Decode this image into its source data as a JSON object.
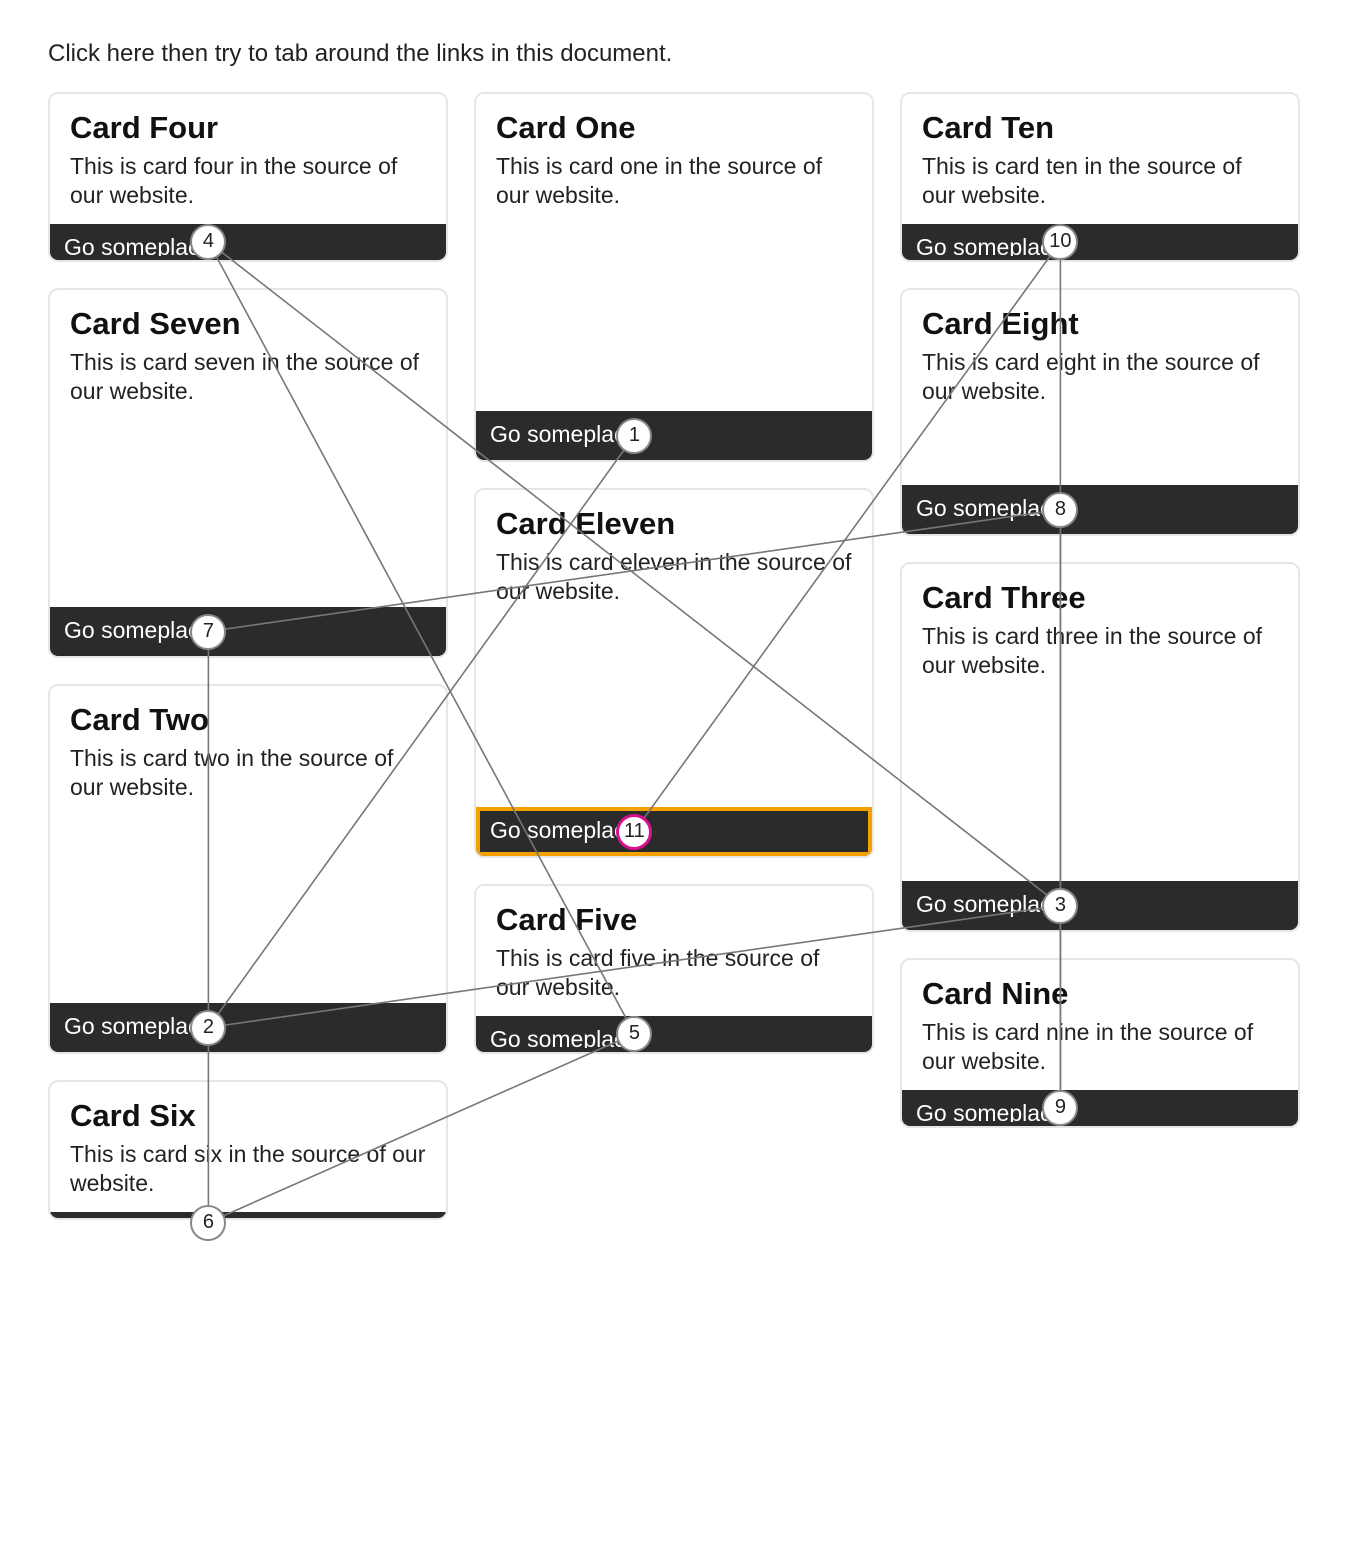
{
  "intro": "Click here then try to tab around the links in this document.",
  "link_label": "Go someplace",
  "focused_tab": 11,
  "cards": {
    "one": {
      "title": "Card One",
      "body": "This is card one in the source of our website.",
      "tab": 1
    },
    "two": {
      "title": "Card Two",
      "body": "This is card two in the source of our website.",
      "tab": 2
    },
    "three": {
      "title": "Card Three",
      "body": "This is card three in the source of our website.",
      "tab": 3
    },
    "four": {
      "title": "Card Four",
      "body": "This is card four in the source of our website.",
      "tab": 4
    },
    "five": {
      "title": "Card Five",
      "body": "This is card five in the source of our website.",
      "tab": 5
    },
    "six": {
      "title": "Card Six",
      "body": "This is card six in the source of our website.",
      "tab": 6
    },
    "seven": {
      "title": "Card Seven",
      "body": "This is card seven in the source of our website.",
      "tab": 7
    },
    "eight": {
      "title": "Card Eight",
      "body": "This is card eight in the source of our website.",
      "tab": 8
    },
    "nine": {
      "title": "Card Nine",
      "body": "This is card nine in the source of our website.",
      "tab": 9
    },
    "ten": {
      "title": "Card Ten",
      "body": "This is card ten in the source of our website.",
      "tab": 10
    },
    "eleven": {
      "title": "Card Eleven",
      "body": "This is card eleven in the source of our website.",
      "tab": 11
    }
  },
  "tab_order": [
    1,
    2,
    3,
    4,
    5,
    6,
    7,
    8,
    9,
    10,
    11
  ]
}
